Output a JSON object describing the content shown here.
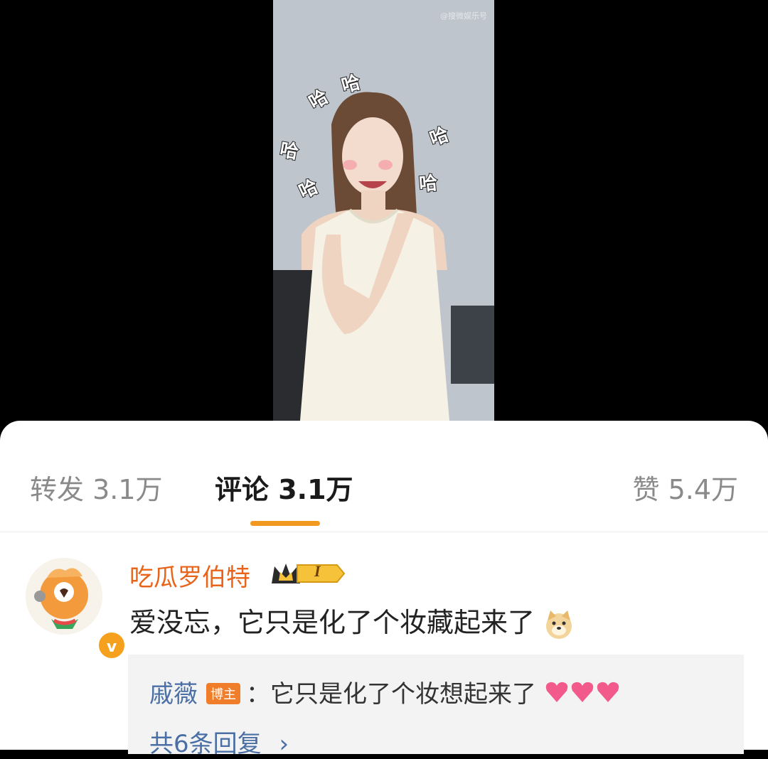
{
  "video": {
    "watermark": "@搜微娱乐号",
    "sticker_text": "哈"
  },
  "tabs": {
    "repost_label": "转发 3.1万",
    "comment_label": "评论 3.1万",
    "like_label": "赞 5.4万"
  },
  "comment": {
    "username": "吃瓜罗伯特",
    "rank_label": "I",
    "verified_symbol": "v",
    "text": "爱没忘，它只是化了个妆藏起来了",
    "emoji": "doge-emoji"
  },
  "reply": {
    "username": "戚薇",
    "host_tag": "博主",
    "text": "：它只是化了个妆想起来了",
    "emoji": "heart-emoji",
    "more_label": "共6条回复",
    "more_chevron": "›"
  },
  "colors": {
    "accent": "#f19a1f",
    "username": "#e8641b",
    "link_blue": "#4a6fa5"
  }
}
